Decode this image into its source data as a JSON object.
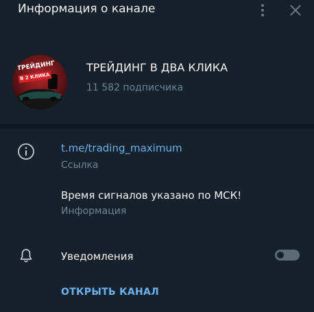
{
  "header": {
    "title": "Информация о канале"
  },
  "channel": {
    "name": "ТРЕЙДИНГ В ДВА КЛИКА",
    "subscribers": "11 582 подписчика",
    "avatar_text_line1": "ТРЕЙДИНГ",
    "avatar_text_line2": "В 2 КЛИКА"
  },
  "link": {
    "value": "t.me/trading_maximum",
    "caption": "Ссылка"
  },
  "description": {
    "value": "Время сигналов указано по МСК!",
    "caption": "Информация"
  },
  "notifications": {
    "label": "Уведомления",
    "enabled": false
  },
  "open_channel_label": "ОТКРЫТЬ КАНАЛ",
  "colors": {
    "background": "#17212b",
    "divider": "#0e1621",
    "accent": "#6ab3f3",
    "muted": "#708499"
  },
  "icons": [
    "more-vertical-icon",
    "close-icon",
    "info-icon",
    "bell-icon"
  ]
}
